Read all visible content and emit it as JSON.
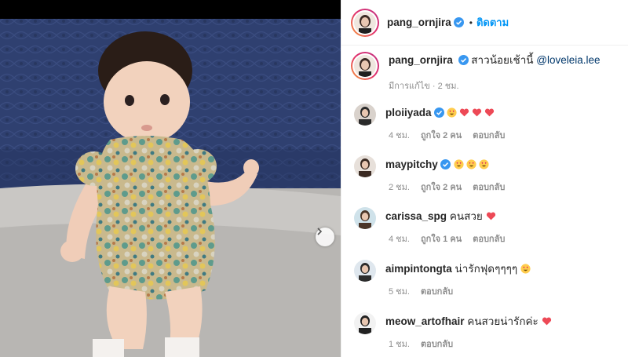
{
  "header": {
    "username": "pang_ornjira",
    "follow_label": "ติดตาม",
    "dot": "•"
  },
  "caption": {
    "username": "pang_ornjira",
    "text": "สาวน้อยเช้านี้",
    "mention": "@loveleia.lee",
    "edited": "มีการแก้ไข · 2 ชม."
  },
  "comments": [
    {
      "username": "ploiiyada",
      "text": "",
      "emoji": [
        "heart-eyes",
        "heart",
        "heart",
        "heart"
      ],
      "time": "4 ชม.",
      "likes": "ถูกใจ 2 คน",
      "reply": "ตอบกลับ"
    },
    {
      "username": "maypitchy",
      "text": "",
      "emoji": [
        "heart-eyes",
        "heart-eyes",
        "heart-eyes"
      ],
      "time": "2 ชม.",
      "likes": "ถูกใจ 2 คน",
      "reply": "ตอบกลับ"
    },
    {
      "username": "carissa_spg",
      "text": "คนสวย",
      "emoji": [
        "heart"
      ],
      "time": "4 ชม.",
      "likes": "ถูกใจ 1 คน",
      "reply": "ตอบกลับ"
    },
    {
      "username": "aimpintongta",
      "text": "น่ารักฟุดๆๆๆๆ",
      "emoji": [
        "heart-eyes"
      ],
      "time": "5 ชม.",
      "likes": "",
      "reply": "ตอบกลับ"
    },
    {
      "username": "meow_artofhair",
      "text": "คนสวยน่ารักค่ะ",
      "emoji": [
        "heart"
      ],
      "time": "1 ชม.",
      "likes": "",
      "reply": "ตอบกลับ"
    }
  ],
  "colors": {
    "accent": "#0095f6",
    "heart": "#ed4956",
    "muted": "#8e8e8e",
    "sofa_blue": "#2c3d6b"
  }
}
